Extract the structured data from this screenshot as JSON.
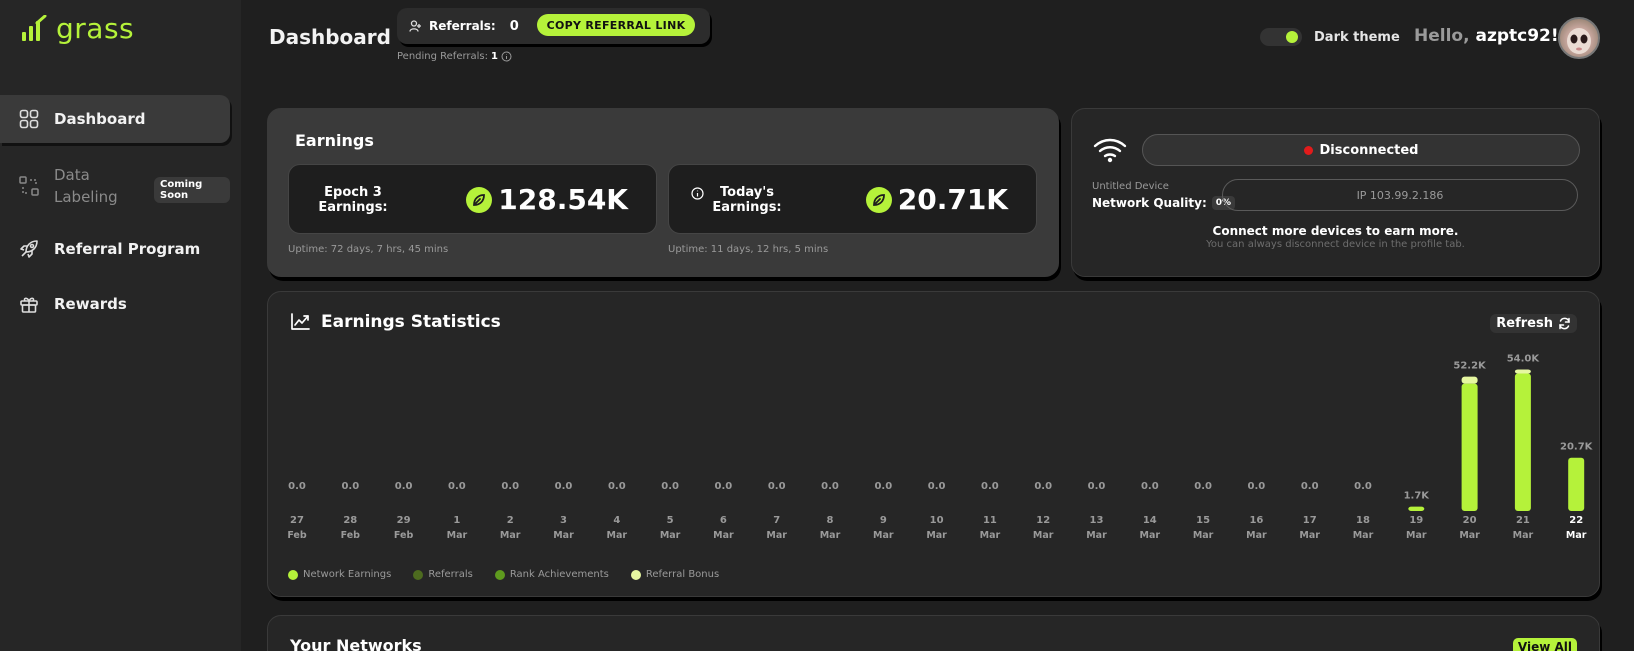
{
  "app": {
    "brand": "grass",
    "accent": "#b5f23a"
  },
  "sidebar": {
    "items": [
      {
        "label": "Dashboard",
        "icon": "grid-icon"
      },
      {
        "label": "Data Labeling",
        "icon": "labeling-icon",
        "badge": "Coming Soon"
      },
      {
        "label": "Referral Program",
        "icon": "rocket-icon"
      },
      {
        "label": "Rewards",
        "icon": "gift-icon"
      }
    ]
  },
  "header": {
    "title": "Dashboard",
    "referrals_label": "Referrals:",
    "referrals_count": "0",
    "copy_button": "COPY REFERRAL LINK",
    "pending_label": "Pending Referrals:",
    "pending_count": "1",
    "theme_label": "Dark theme",
    "greeting": "Hello,",
    "username": "azptc92!"
  },
  "earnings": {
    "title": "Earnings",
    "epoch_label": "Epoch 3 Earnings:",
    "epoch_value": "128.54K",
    "epoch_uptime": "Uptime: 72 days, 7 hrs, 45 mins",
    "today_label": "Today's Earnings:",
    "today_value": "20.71K",
    "today_uptime": "Uptime: 11 days, 12 hrs, 5 mins"
  },
  "device": {
    "status": "Disconnected",
    "name": "Untitled Device",
    "network_quality_label": "Network Quality:",
    "network_quality_value": "0%",
    "ip": "IP 103.99.2.186",
    "connect_text": "Connect more devices to earn more.",
    "connect_sub": "You can always disconnect device in the profile tab."
  },
  "stats": {
    "title": "Earnings Statistics",
    "refresh_label": "Refresh"
  },
  "networks": {
    "title": "Your Networks",
    "view_all": "View All"
  },
  "chart_data": {
    "type": "bar",
    "categories": [
      {
        "day": "27",
        "month": "Feb"
      },
      {
        "day": "28",
        "month": "Feb"
      },
      {
        "day": "29",
        "month": "Feb"
      },
      {
        "day": "1",
        "month": "Mar"
      },
      {
        "day": "2",
        "month": "Mar"
      },
      {
        "day": "3",
        "month": "Mar"
      },
      {
        "day": "4",
        "month": "Mar"
      },
      {
        "day": "5",
        "month": "Mar"
      },
      {
        "day": "6",
        "month": "Mar"
      },
      {
        "day": "7",
        "month": "Mar"
      },
      {
        "day": "8",
        "month": "Mar"
      },
      {
        "day": "9",
        "month": "Mar"
      },
      {
        "day": "10",
        "month": "Mar"
      },
      {
        "day": "11",
        "month": "Mar"
      },
      {
        "day": "12",
        "month": "Mar"
      },
      {
        "day": "13",
        "month": "Mar"
      },
      {
        "day": "14",
        "month": "Mar"
      },
      {
        "day": "15",
        "month": "Mar"
      },
      {
        "day": "16",
        "month": "Mar"
      },
      {
        "day": "17",
        "month": "Mar"
      },
      {
        "day": "18",
        "month": "Mar"
      },
      {
        "day": "19",
        "month": "Mar"
      },
      {
        "day": "20",
        "month": "Mar"
      },
      {
        "day": "21",
        "month": "Mar"
      },
      {
        "day": "22",
        "month": "Mar"
      }
    ],
    "value_labels": [
      "0.0",
      "0.0",
      "0.0",
      "0.0",
      "0.0",
      "0.0",
      "0.0",
      "0.0",
      "0.0",
      "0.0",
      "0.0",
      "0.0",
      "0.0",
      "0.0",
      "0.0",
      "0.0",
      "0.0",
      "0.0",
      "0.0",
      "0.0",
      "0.0",
      "1.7K",
      "52.2K",
      "54.0K",
      "20.7K"
    ],
    "series": [
      {
        "name": "Network Earnings",
        "color": "#b5f23a",
        "values": [
          0,
          0,
          0,
          0,
          0,
          0,
          0,
          0,
          0,
          0,
          0,
          0,
          0,
          0,
          0,
          0,
          0,
          0,
          0,
          0,
          0,
          1700,
          49500,
          53400,
          20700
        ]
      },
      {
        "name": "Referrals",
        "color": "#4d6b1f",
        "values": [
          0,
          0,
          0,
          0,
          0,
          0,
          0,
          0,
          0,
          0,
          0,
          0,
          0,
          0,
          0,
          0,
          0,
          0,
          0,
          0,
          0,
          0,
          0,
          0,
          0
        ]
      },
      {
        "name": "Rank Achievements",
        "color": "#5e9a1e",
        "values": [
          0,
          0,
          0,
          0,
          0,
          0,
          0,
          0,
          0,
          0,
          0,
          0,
          0,
          0,
          0,
          0,
          0,
          0,
          0,
          0,
          0,
          0,
          0,
          0,
          0
        ]
      },
      {
        "name": "Referral Bonus",
        "color": "#e6f7a0",
        "values": [
          0,
          0,
          0,
          0,
          0,
          0,
          0,
          0,
          0,
          0,
          0,
          0,
          0,
          0,
          0,
          0,
          0,
          0,
          0,
          0,
          0,
          0,
          2700,
          600,
          0
        ]
      }
    ],
    "highlight_index": 24,
    "ylim": [
      0,
      54000
    ],
    "grid": false,
    "legend": "bottom-left"
  }
}
